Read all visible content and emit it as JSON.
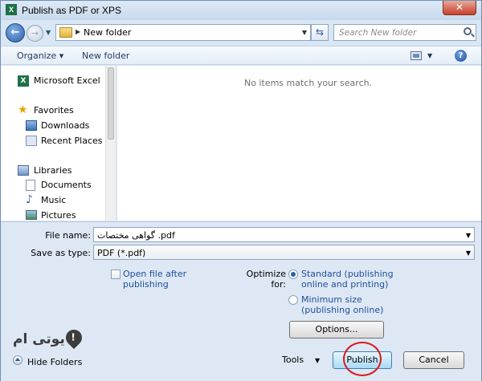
{
  "window": {
    "title": "Publish as PDF or XPS",
    "icon": "excel-icon",
    "close_glyph": "✕"
  },
  "address_bar": {
    "path": "New folder",
    "search_placeholder": "Search New folder"
  },
  "toolbar": {
    "organize_label": "Organize ▾",
    "new_folder_label": "New folder",
    "help_glyph": "?"
  },
  "sidebar": {
    "items": [
      {
        "label": "Microsoft Excel",
        "icon": "excel-icon"
      },
      {
        "label": "Favorites",
        "icon": "star-icon"
      },
      {
        "label": "Downloads",
        "icon": "downloads-icon"
      },
      {
        "label": "Recent Places",
        "icon": "recent-places-icon"
      },
      {
        "label": "Libraries",
        "icon": "libraries-icon"
      },
      {
        "label": "Documents",
        "icon": "documents-icon"
      },
      {
        "label": "Music",
        "icon": "music-icon"
      },
      {
        "label": "Pictures",
        "icon": "pictures-icon"
      }
    ]
  },
  "content": {
    "empty_message": "No items match your search."
  },
  "form": {
    "file_name_label": "File name:",
    "file_name_value": "گواهی مختصات .pdf",
    "save_as_type_label": "Save as type:",
    "save_as_type_value": "PDF (*.pdf)",
    "open_after_line1": "Open file after",
    "open_after_line2": "publishing",
    "open_after_checked": false,
    "optimize_label": "Optimize for:",
    "standard_line1": "Standard (publishing",
    "standard_line2": "online and printing)",
    "standard_selected": true,
    "minimum_line1": "Minimum size",
    "minimum_line2": "(publishing online)",
    "minimum_selected": false,
    "options_label": "Options..."
  },
  "footer": {
    "hide_folders_label": "Hide Folders",
    "tools_label": "Tools",
    "publish_label": "Publish",
    "cancel_label": "Cancel"
  },
  "watermark": {
    "text": "یوتی ام"
  },
  "colors": {
    "accent": "#2d5fa6",
    "link_text": "#1f4e9c",
    "highlight": "#d91c1c"
  }
}
